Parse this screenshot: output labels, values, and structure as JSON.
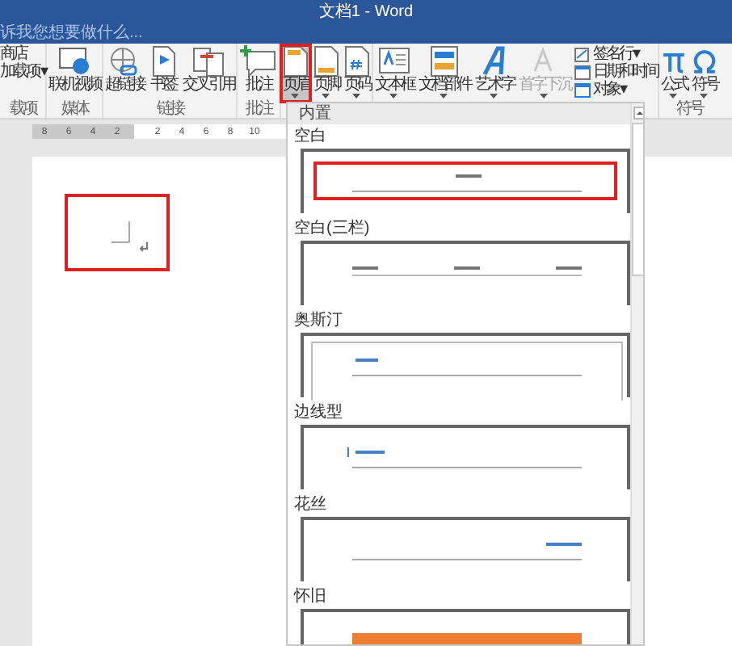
{
  "window": {
    "title": "文档1 - Word"
  },
  "tell_me": {
    "placeholder": "诉我您想要做什么..."
  },
  "ribbon": {
    "groups": [
      {
        "label": "载项",
        "buttons": [
          {
            "label": "商店",
            "kind": "small"
          },
          {
            "label": "加载项 ▾",
            "kind": "small"
          }
        ]
      },
      {
        "label": "媒体",
        "buttons": [
          {
            "label": "联机视频",
            "kind": "large"
          }
        ]
      },
      {
        "label": "链接",
        "buttons": [
          {
            "label": "超链接",
            "kind": "large"
          },
          {
            "label": "书签",
            "kind": "large"
          },
          {
            "label": "交叉引用",
            "kind": "large"
          }
        ]
      },
      {
        "label": "批注",
        "buttons": [
          {
            "label": "批注",
            "kind": "large"
          }
        ]
      },
      {
        "buttons": [
          {
            "label": "页眉",
            "kind": "menu",
            "selected": true
          },
          {
            "label": "页脚",
            "kind": "menu",
            "selected": false
          },
          {
            "label": "页码",
            "kind": "menu",
            "selected": false
          }
        ]
      },
      {
        "buttons": [
          {
            "label": "文本框",
            "kind": "menu",
            "disabled": false
          },
          {
            "label": "文档部件",
            "kind": "menu",
            "disabled": false
          },
          {
            "label": "艺术字",
            "kind": "menu",
            "disabled": false
          },
          {
            "label": "首字下沉",
            "kind": "menu",
            "disabled": true
          },
          {
            "label": "签名行 ▾",
            "kind": "small"
          },
          {
            "label": "日期和时间",
            "kind": "small"
          },
          {
            "label": "对象 ▾",
            "kind": "small"
          }
        ]
      },
      {
        "label": "符号",
        "buttons": [
          {
            "label": "公式",
            "kind": "menu"
          },
          {
            "label": "符号",
            "kind": "menu"
          }
        ]
      }
    ]
  },
  "ruler": {
    "ticks": [
      "8",
      "6",
      "4",
      "2",
      "2",
      "4",
      "6",
      "8",
      "10"
    ]
  },
  "header_gallery": {
    "title": "内置",
    "items": [
      {
        "label": "空白",
        "kind": "blank",
        "selected": true
      },
      {
        "label": "空白(三栏)",
        "kind": "three-column",
        "selected": false
      },
      {
        "label": "奥斯汀",
        "kind": "austin",
        "selected": false
      },
      {
        "label": "边线型",
        "kind": "sideline",
        "selected": false
      },
      {
        "label": "花丝",
        "kind": "filigree",
        "selected": false
      },
      {
        "label": "怀旧",
        "kind": "retro",
        "selected": false
      }
    ]
  }
}
